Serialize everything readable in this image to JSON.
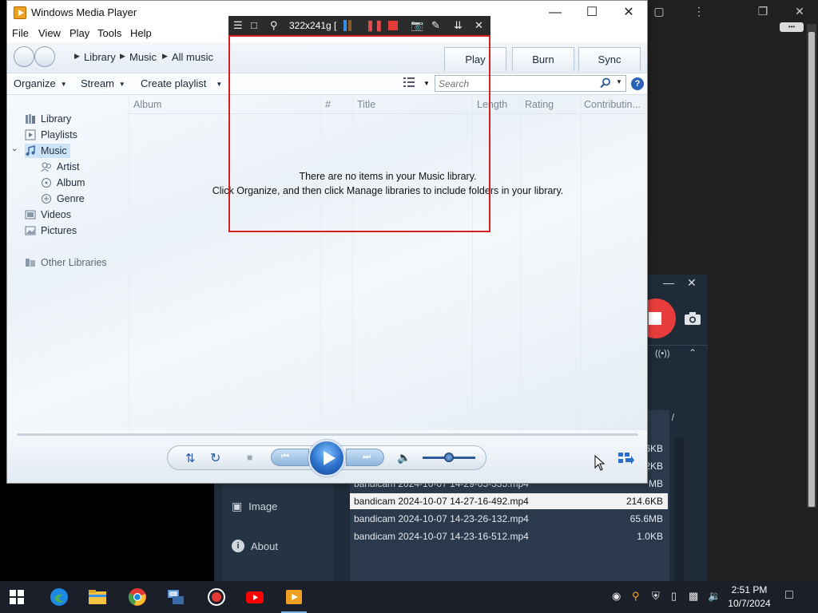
{
  "wmp": {
    "title": "Windows Media Player",
    "menu": [
      "File",
      "View",
      "Play",
      "Tools",
      "Help"
    ],
    "breadcrumb": [
      "Library",
      "Music",
      "All music"
    ],
    "tabs": [
      "Play",
      "Burn",
      "Sync"
    ],
    "toolbar": {
      "organize": "Organize",
      "stream": "Stream",
      "create_playlist": "Create playlist"
    },
    "search_placeholder": "Search",
    "nav": {
      "library": "Library",
      "playlists": "Playlists",
      "music": "Music",
      "artist": "Artist",
      "album": "Album",
      "genre": "Genre",
      "videos": "Videos",
      "pictures": "Pictures",
      "other_libraries": "Other Libraries"
    },
    "columns": [
      "Album",
      "#",
      "Title",
      "Length",
      "Rating",
      "Contributin..."
    ],
    "empty_line1": "There are no items in your Music library.",
    "empty_line2": "Click Organize, and then click Manage libraries to include folders in your library."
  },
  "capture": {
    "size_label": "322x241g ["
  },
  "bandicam": {
    "side_items": [
      "Image",
      "About"
    ],
    "files": [
      {
        "name": "bandicam 2024-10-07 14-27-16-492.mp4",
        "size": "214.6KB",
        "selected": true
      },
      {
        "name": "bandicam 2024-10-07 14-23-26-132.mp4",
        "size": "65.6MB",
        "selected": false
      },
      {
        "name": "bandicam 2024-10-07 14-23-16-512.mp4",
        "size": "1.0KB",
        "selected": false
      }
    ],
    "partial_sizes": [
      "6KB",
      "2KB",
      "MB"
    ],
    "partial_row": "bandicam 2024-10-07 14-29-05-335.mp4",
    "folder_label": "/"
  },
  "taskbar": {
    "time": "2:51 PM",
    "date": "10/7/2024"
  },
  "colors": {
    "accent": "#2a6fc9",
    "record_red": "#e63c3c",
    "capture_frame": "#d42020"
  }
}
